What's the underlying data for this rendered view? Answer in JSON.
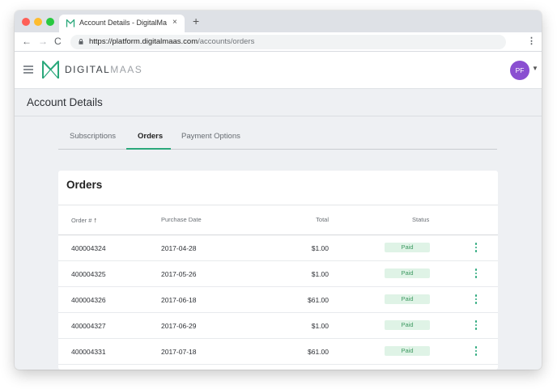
{
  "browser": {
    "tab_title": "Account Details - DigitalMaas",
    "tab_close": "×",
    "new_tab": "+",
    "back": "←",
    "forward": "→",
    "reload": "C",
    "url_host": "https://platform.digitalmaas.com",
    "url_path": "/accounts/orders",
    "bookmark": "☆",
    "menu": "⋮"
  },
  "app": {
    "logo_text_bold": "DIGITAL",
    "logo_text_light": "MAAS",
    "avatar_initials": "PF",
    "avatar_caret": "▼",
    "brand_color": "#2aa87b",
    "avatar_color": "#8a4fd1"
  },
  "page": {
    "title": "Account Details",
    "tabs": [
      {
        "label": "Subscriptions",
        "active": false
      },
      {
        "label": "Orders",
        "active": true
      },
      {
        "label": "Payment Options",
        "active": false
      }
    ]
  },
  "orders": {
    "title": "Orders",
    "columns": {
      "order": "Order #",
      "sort_indicator": "↑",
      "purchase_date": "Purchase Date",
      "total": "Total",
      "status": "Status"
    },
    "rows": [
      {
        "order": "400004324",
        "date": "2017-04-28",
        "total": "$1.00",
        "status": "Paid"
      },
      {
        "order": "400004325",
        "date": "2017-05-26",
        "total": "$1.00",
        "status": "Paid"
      },
      {
        "order": "400004326",
        "date": "2017-06-18",
        "total": "$61.00",
        "status": "Paid"
      },
      {
        "order": "400004327",
        "date": "2017-06-29",
        "total": "$1.00",
        "status": "Paid"
      },
      {
        "order": "400004331",
        "date": "2017-07-18",
        "total": "$61.00",
        "status": "Paid"
      }
    ]
  }
}
